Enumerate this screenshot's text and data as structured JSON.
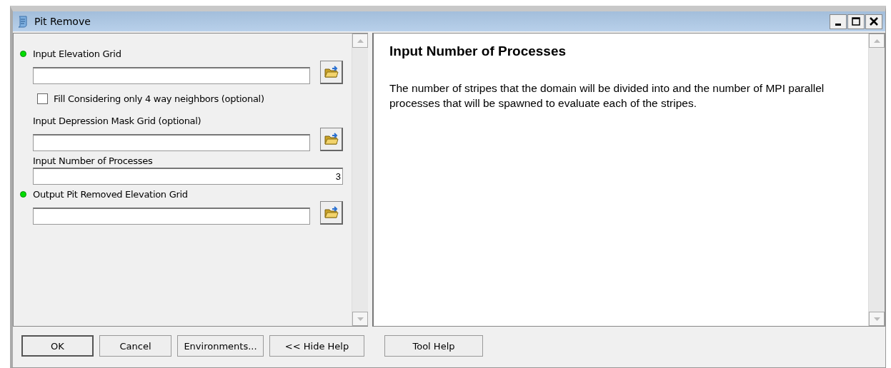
{
  "window": {
    "title": "Pit Remove"
  },
  "parameters": [
    {
      "kind": "file",
      "label": "Input Elevation Grid",
      "required": true
    },
    {
      "kind": "checkbox",
      "label": "Fill Considering only 4 way neighbors (optional)",
      "checked": false
    },
    {
      "kind": "file",
      "label": "Input Depression Mask Grid (optional)",
      "required": false
    },
    {
      "kind": "number",
      "label": "Input Number of Processes",
      "required": false,
      "value": "3"
    },
    {
      "kind": "file",
      "label": "Output Pit Removed Elevation Grid",
      "required": true
    }
  ],
  "help": {
    "title": "Input Number of Processes",
    "text": "The number of stripes that the domain will be divided into and the number of MPI parallel processes that will be spawned to evaluate each of the stripes."
  },
  "buttons": [
    {
      "label": "OK",
      "default": true
    },
    {
      "label": "Cancel",
      "default": false
    },
    {
      "label": "Environments...",
      "default": false
    },
    {
      "label": "<< Hide Help",
      "default": false
    },
    {
      "label": "Tool Help",
      "default": false
    }
  ]
}
